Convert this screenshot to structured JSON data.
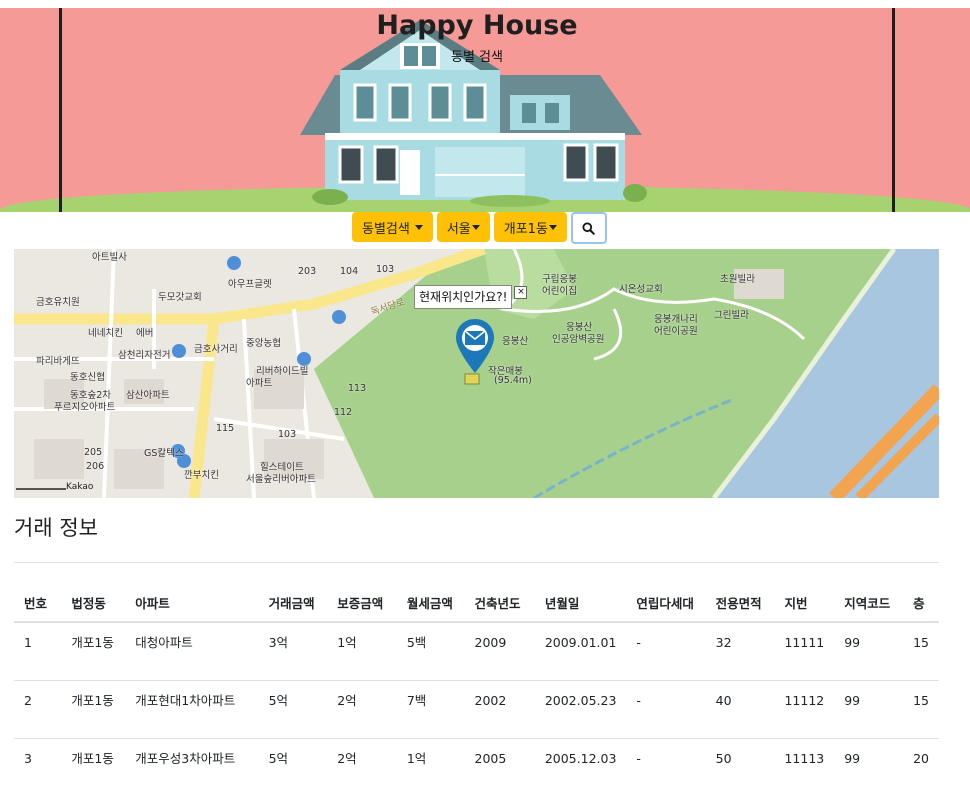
{
  "header": {
    "title": "Happy House",
    "subtitle": "동별 검색"
  },
  "controls": {
    "search_type": "동별검색",
    "city": "서울",
    "dong": "개포1동",
    "search_icon": "search-icon"
  },
  "map": {
    "infowindow_text": "현재위치인가요?!",
    "marker_icon": "envelope-marker-icon",
    "labels": [
      "아트빌사",
      "아우프글렛",
      "103",
      "203",
      "104",
      "금호유치원",
      "두모갓교회",
      "구립응봉",
      "어린이집",
      "시온성교회",
      "초원빌라",
      "네네치킨",
      "에버",
      "중앙농협",
      "응봉산",
      "응봉산",
      "인공암벽공원",
      "응봉개나리",
      "어린이공원",
      "그린빌라",
      "파리바게뜨",
      "삼천리자전거",
      "금호사거리",
      "리버하이드빌",
      "아파트",
      "작은매봉",
      "(95.4m)",
      "동호신협",
      "동호숲2차",
      "푸르지오아파트",
      "삼산아파트",
      "113",
      "112",
      "115",
      "103",
      "205",
      "206",
      "GS칼텍스",
      "깐부치킨",
      "힐스테이트",
      "서울숲리버아파트",
      "독서당로"
    ],
    "copyright": "Kakao"
  },
  "section": {
    "title": "거래 정보"
  },
  "table": {
    "headers": [
      "번호",
      "법정동",
      "아파트",
      "거래금액",
      "보증금액",
      "월세금액",
      "건축년도",
      "년월일",
      "연립다세대",
      "전용면적",
      "지번",
      "지역코드",
      "층"
    ],
    "rows": [
      [
        "1",
        "개포1동",
        "대청아파트",
        "3억",
        "1억",
        "5백",
        "2009",
        "2009.01.01",
        "-",
        "32",
        "11111",
        "99",
        "15"
      ],
      [
        "2",
        "개포1동",
        "개포현대1차아파트",
        "5억",
        "2억",
        "7백",
        "2002",
        "2002.05.23",
        "-",
        "40",
        "11112",
        "99",
        "15"
      ],
      [
        "3",
        "개포1동",
        "개포우성3차아파트",
        "5억",
        "2억",
        "1억",
        "2005",
        "2005.12.03",
        "-",
        "50",
        "11113",
        "99",
        "20"
      ]
    ]
  },
  "colors": {
    "accent": "#ffc107",
    "hero_bg": "#f59a97",
    "map_park": "#a7d08c",
    "map_river": "#a9c6e0"
  }
}
